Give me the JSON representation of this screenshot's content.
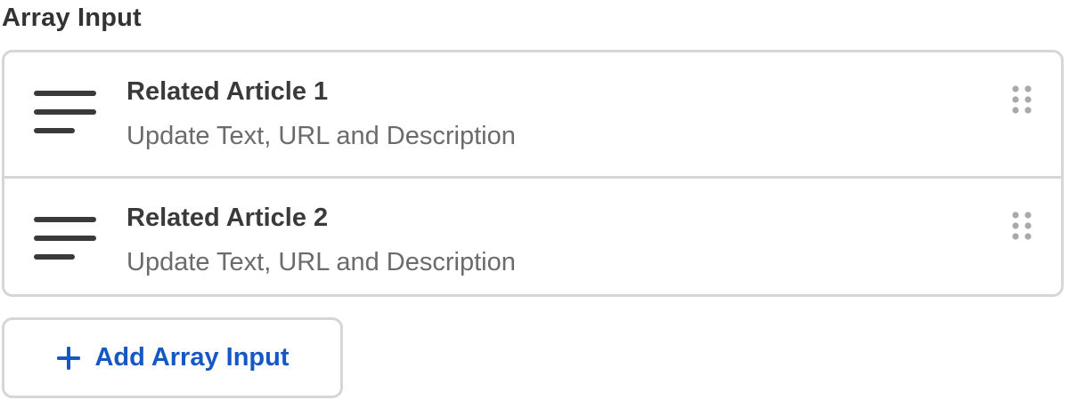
{
  "field": {
    "label": "Array Input"
  },
  "items": [
    {
      "title": "Related Article 1",
      "subtitle": "Update Text, URL and Description",
      "icon": "text-lines-icon"
    },
    {
      "title": "Related Article 2",
      "subtitle": "Update Text, URL and Description",
      "icon": "text-lines-icon"
    }
  ],
  "add_button": {
    "label": "Add Array Input",
    "icon": "plus-icon"
  },
  "colors": {
    "border": "#d6d6d6",
    "title_text": "#3a3a3a",
    "subtitle_text": "#6b6b6b",
    "accent": "#1458c6",
    "handle_dots": "#a9a9a9"
  }
}
